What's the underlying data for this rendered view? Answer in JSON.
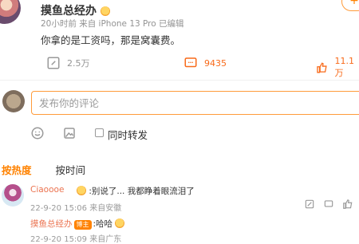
{
  "post": {
    "author": "摸鱼总经办",
    "time": "20小时前",
    "source": "来自 iPhone 13 Pro 已编辑",
    "text": "你拿的是工资吗，那是窝囊费。",
    "reposts": "2.5万",
    "comments": "9435",
    "likes": "11.1万",
    "follow_label": "+"
  },
  "composer": {
    "placeholder": "发布你的评论",
    "repost_label": "同时转发"
  },
  "tabs": [
    "按热度",
    "按时间"
  ],
  "comments": [
    {
      "author": "Ciaoooe",
      "text": ":别说了... 我都睁着眼流泪了",
      "time": "22-9-20 15:06",
      "source": "来自安徽"
    }
  ],
  "reply": {
    "author": "摸鱼总经办",
    "badge": "博主",
    "text": ":哈哈",
    "time": "22-9-20 15:09",
    "source": "来自广东"
  },
  "colors": {
    "accent": "#ff8200",
    "name": "#eb7350"
  },
  "icons": [
    "repost-icon",
    "comment-icon",
    "like-icon",
    "emoji-icon",
    "image-icon",
    "checkbox-icon",
    "reply-icon",
    "share-icon"
  ]
}
